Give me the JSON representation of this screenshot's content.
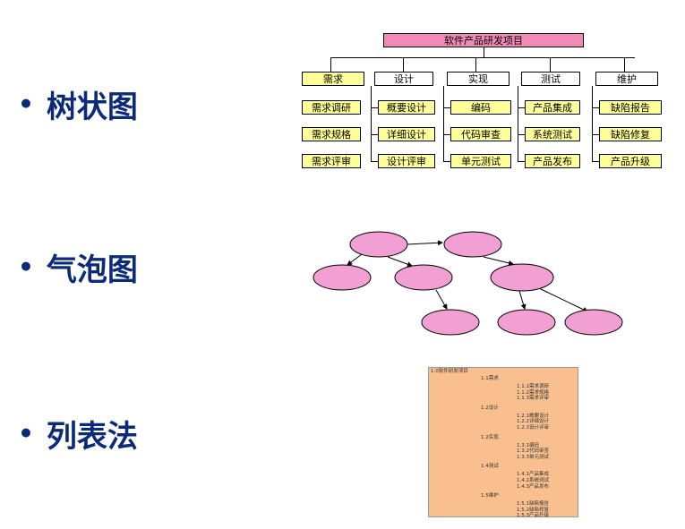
{
  "bullets": [
    "树状图",
    "气泡图",
    "列表法"
  ],
  "tree": {
    "root": "软件产品研发项目",
    "columns": [
      {
        "category": "需求",
        "items": [
          "需求调研",
          "需求规格",
          "需求评审"
        ]
      },
      {
        "category": "设计",
        "items": [
          "概要设计",
          "详细设计",
          "设计评审"
        ]
      },
      {
        "category": "实现",
        "items": [
          "编码",
          "代码审查",
          "单元测试"
        ]
      },
      {
        "category": "测试",
        "items": [
          "产品集成",
          "系统测试",
          "产品发布"
        ]
      },
      {
        "category": "维护",
        "items": [
          "缺陷报告",
          "缺陷修复",
          "产品升级"
        ]
      }
    ]
  },
  "list": {
    "root": "1.0软件研发项目",
    "sections": [
      {
        "label": "1.1需求",
        "items": [
          "1.1.1需求调研",
          "1.1.2需求规格",
          "1.1.3需求评审"
        ]
      },
      {
        "label": "1.2设计",
        "items": [
          "1.2.1概要设计",
          "1.2.2详细设计",
          "1.2.3设计评审"
        ]
      },
      {
        "label": "1.2实现",
        "items": [
          "1.3.1编码",
          "1.3.2代码审查",
          "1.3.3单元测试"
        ]
      },
      {
        "label": "1.4测试",
        "items": [
          "1.4.1产品集成",
          "1.4.2系统测试",
          "1.4.3产品发布"
        ]
      },
      {
        "label": "1.5维护",
        "items": [
          "1.5.1缺陷报告",
          "1.5.2缺陷修复",
          "1.5.3产品升级"
        ]
      }
    ]
  },
  "colors": {
    "bullet_text": "#0b2a7a",
    "root_fill": "#f08ab7",
    "item_fill": "#ffff99",
    "bubble_fill": "#f29fd3",
    "list_fill": "#f9bf8f"
  }
}
